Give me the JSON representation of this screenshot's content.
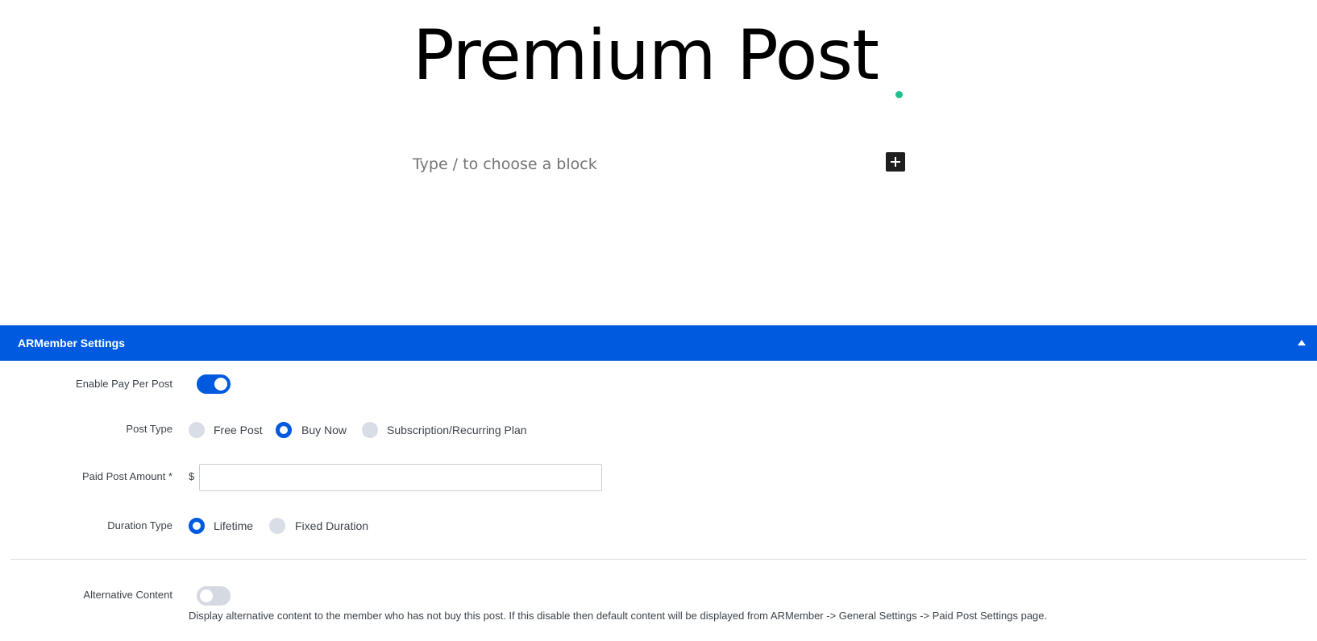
{
  "editor": {
    "title": "Premium Post",
    "block_placeholder": "Type / to choose a block"
  },
  "panel": {
    "title": "ARMember Settings",
    "enable_pay_per_post": {
      "label": "Enable Pay Per Post",
      "enabled": true
    },
    "post_type": {
      "label": "Post Type",
      "options": [
        "Free Post",
        "Buy Now",
        "Subscription/Recurring Plan"
      ],
      "selected": "Buy Now"
    },
    "paid_post_amount": {
      "label": "Paid Post Amount *",
      "currency": "$",
      "value": ""
    },
    "duration_type": {
      "label": "Duration Type",
      "options": [
        "Lifetime",
        "Fixed Duration"
      ],
      "selected": "Lifetime"
    },
    "alternative_content": {
      "label": "Alternative Content",
      "enabled": false,
      "help": "Display alternative content to the member who has not buy this post. If this disable then default content will be displayed from ARMember -> General Settings -> Paid Post Settings page."
    }
  },
  "colors": {
    "accent": "#005ae0",
    "title_dot": "#1ec08e",
    "radio_unchecked": "#d9dde6"
  }
}
